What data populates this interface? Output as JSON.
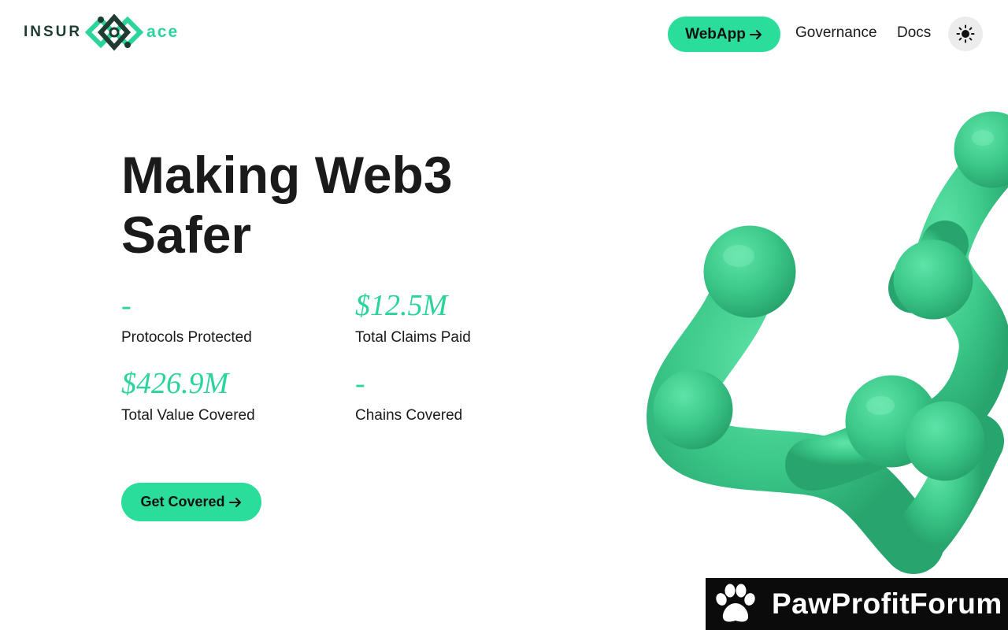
{
  "brand": {
    "left_text": "INSUR",
    "right_text": "ace",
    "colors": {
      "accent": "#2bdd9a",
      "dark": "#1f3b32"
    }
  },
  "nav": {
    "webapp_label": "WebApp",
    "governance_label": "Governance",
    "docs_label": "Docs",
    "theme_icon": "sun-icon"
  },
  "hero": {
    "title_line1": "Making Web3",
    "title_line2": "Safer"
  },
  "stats": [
    {
      "value": "-",
      "label": "Protocols Protected"
    },
    {
      "value": "$12.5M",
      "label": "Total Claims Paid"
    },
    {
      "value": "$426.9M",
      "label": "Total Value Covered"
    },
    {
      "value": "-",
      "label": "Chains Covered"
    }
  ],
  "cta": {
    "label": "Get Covered"
  },
  "watermark": {
    "text": "PawProfitForum",
    "icon": "paw-icon"
  }
}
